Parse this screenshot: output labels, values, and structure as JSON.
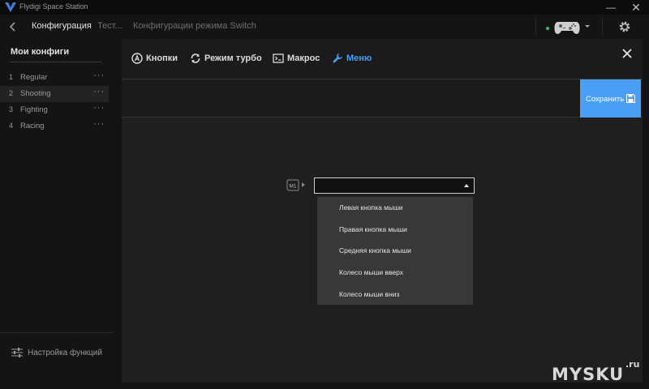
{
  "window": {
    "title": "Flydigi Space Station",
    "minimize_glyph": "—",
    "close_glyph": "✕"
  },
  "navbar": {
    "tabs": [
      {
        "label": "Конфигурация",
        "active": true
      },
      {
        "label": "Тест...",
        "active": false
      },
      {
        "label": "Конфигурации режима Switch",
        "active": false
      }
    ],
    "device_status_color": "#37c05a",
    "icons": [
      "back-arrow-icon",
      "gamepad-icon",
      "chevron-down-icon",
      "gear-icon"
    ]
  },
  "sidebar": {
    "title": "Мои конфиги",
    "configs": [
      {
        "num": "1",
        "label": "Regular",
        "more": "···",
        "selected": false
      },
      {
        "num": "2",
        "label": "Shooting",
        "more": "···",
        "selected": true
      },
      {
        "num": "3",
        "label": "Fighting",
        "more": "···",
        "selected": false
      },
      {
        "num": "4",
        "label": "Racing",
        "more": "···",
        "selected": false
      }
    ],
    "footer_label": "Настройка функций"
  },
  "panel": {
    "tabs": [
      {
        "label": "Кнопки",
        "icon": "a-button-icon",
        "active": false
      },
      {
        "label": "Режим турбо",
        "icon": "turbo-icon",
        "active": false
      },
      {
        "label": "Макрос",
        "icon": "macro-icon",
        "active": false
      },
      {
        "label": "Меню",
        "icon": "wrench-icon",
        "active": true
      }
    ],
    "save_label": "Сохранить",
    "accent_color": "#4a9ff5",
    "mapping": {
      "button_label": "M1",
      "selected_value": "",
      "options": [
        "Левая кнопка мыши",
        "Правая кнопка мыши",
        "Средняя кнопка мыши",
        "Колесо мыши вверх",
        "Колесо мыши вниз"
      ]
    }
  },
  "watermark": {
    "text": "MYSKU",
    "suffix": ".ru"
  }
}
